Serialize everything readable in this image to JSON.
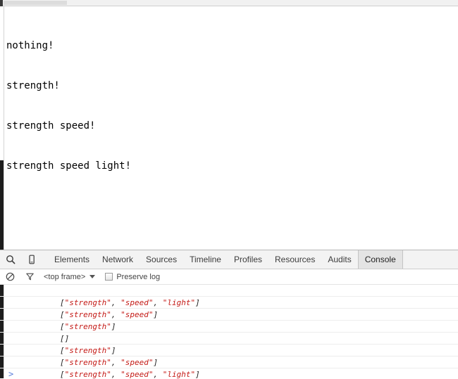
{
  "window": {
    "top_scrollbar": "horizontal-scrollbar"
  },
  "page": {
    "lines": [
      "nothing!",
      "strength!",
      "strength speed!",
      "strength speed light!"
    ]
  },
  "devtools": {
    "toolbar": {
      "search_icon": "search-icon",
      "device_icon": "device-toggle-icon",
      "tabs": [
        {
          "label": "Elements",
          "active": false
        },
        {
          "label": "Network",
          "active": false
        },
        {
          "label": "Sources",
          "active": false
        },
        {
          "label": "Timeline",
          "active": false
        },
        {
          "label": "Profiles",
          "active": false
        },
        {
          "label": "Resources",
          "active": false
        },
        {
          "label": "Audits",
          "active": false
        },
        {
          "label": "Console",
          "active": true
        }
      ]
    },
    "options": {
      "clear_icon": "clear-console-icon",
      "filter_icon": "filter-funnel-icon",
      "frame_selector_value": "<top frame>",
      "preserve_log_label": "Preserve log",
      "preserve_log_checked": false
    },
    "console": {
      "messages": [
        {
          "open": "[",
          "items": [
            "\"strength\"",
            "\"speed\"",
            "\"light\""
          ],
          "close": "]"
        },
        {
          "open": "[",
          "items": [
            "\"strength\"",
            "\"speed\""
          ],
          "close": "]"
        },
        {
          "open": "[",
          "items": [
            "\"strength\""
          ],
          "close": "]"
        },
        {
          "open": "[",
          "items": [],
          "close": "]"
        },
        {
          "open": "[",
          "items": [
            "\"strength\""
          ],
          "close": "]"
        },
        {
          "open": "[",
          "items": [
            "\"strength\"",
            "\"speed\""
          ],
          "close": "]"
        },
        {
          "open": "[",
          "items": [
            "\"strength\"",
            "\"speed\"",
            "\"light\""
          ],
          "close": "]"
        }
      ],
      "prompt_caret": ">"
    }
  },
  "colors": {
    "string_red": "#c41a16",
    "punctuation": "#222222",
    "prompt_blue": "#4a6fd4",
    "toolbar_bg": "#f3f3f3",
    "active_tab_bg": "#e4e4e4"
  }
}
